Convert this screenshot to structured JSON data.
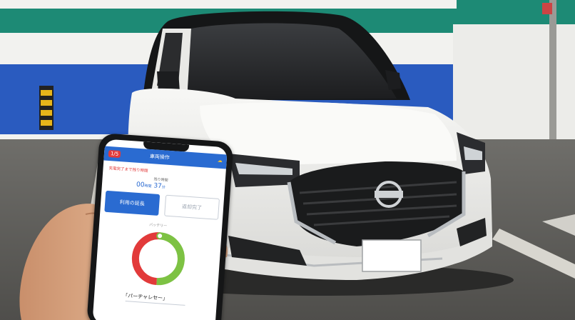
{
  "app": {
    "header_title": "車両操作",
    "header_badge": "1/5",
    "alert_text": "充電完了まで残り時間",
    "time_label": "残り時間",
    "time_value": "00",
    "time_unit": "時間",
    "time_minutes": "37",
    "minute_unit": "分",
    "primary_button": "利用の延長",
    "secondary_button": "返却完了",
    "ring_label": "バッテリー",
    "ring_segments": [
      {
        "name": "green",
        "color": "#7dc243",
        "fraction": 0.5
      },
      {
        "name": "red",
        "color": "#e23a3a",
        "fraction": 0.5
      }
    ],
    "status_text": "「パーヂャレセー」",
    "accent_color": "#2a6bd1"
  },
  "scene": {
    "wall_stripe_color": "#1d8a75",
    "wall_panel_color": "#2a5bbf",
    "car_color": "#f4f4f2"
  }
}
